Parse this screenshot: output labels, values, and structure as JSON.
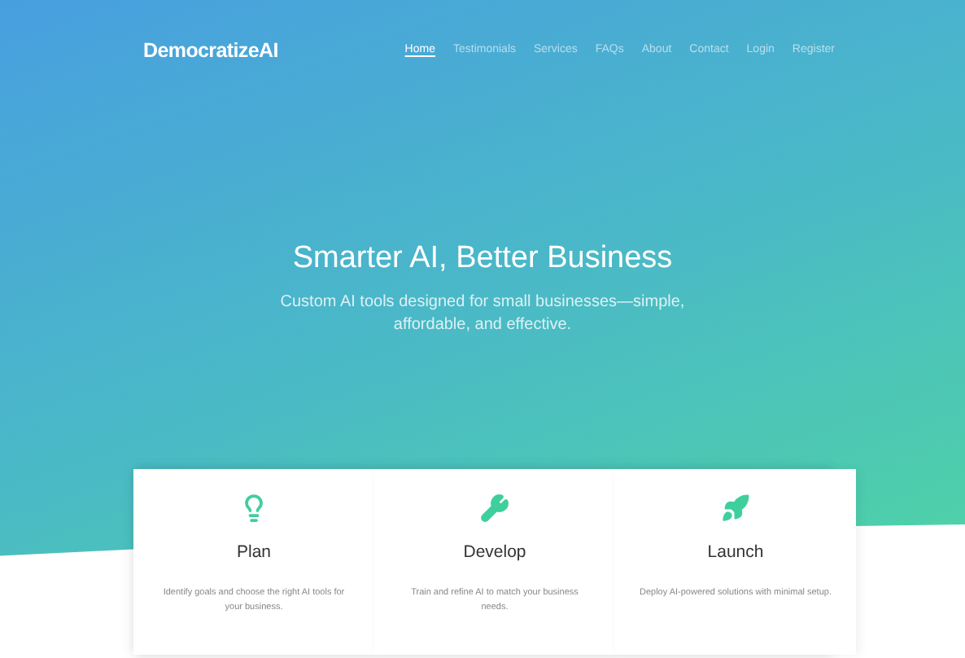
{
  "brand": "DemocratizeAI",
  "nav": [
    {
      "label": "Home",
      "selected": true
    },
    {
      "label": "Testimonials",
      "selected": false
    },
    {
      "label": "Services",
      "selected": false
    },
    {
      "label": "FAQs",
      "selected": false
    },
    {
      "label": "About",
      "selected": false
    },
    {
      "label": "Contact",
      "selected": false
    },
    {
      "label": "Login",
      "selected": false
    },
    {
      "label": "Register",
      "selected": false
    }
  ],
  "hero": {
    "title": "Smarter AI, Better Business",
    "subtitle": "Custom AI tools designed for small businesses—simple, affordable, and effective."
  },
  "features": [
    {
      "kind": "bulb",
      "title": "Plan",
      "text": "Identify goals and choose the right AI tools for your business."
    },
    {
      "kind": "wrench",
      "title": "Develop",
      "text": "Train and refine AI to match your business needs."
    },
    {
      "kind": "rocket",
      "title": "Launch",
      "text": "Deploy AI-powered solutions with minimal setup."
    }
  ]
}
